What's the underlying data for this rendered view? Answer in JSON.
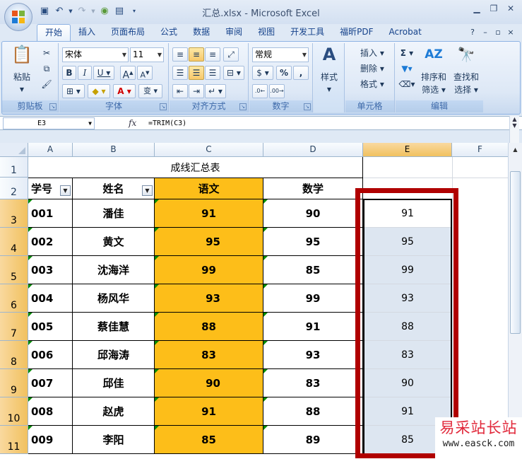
{
  "window": {
    "title": "汇总.xlsx - Microsoft Excel"
  },
  "ribbon": {
    "tabs": [
      "开始",
      "插入",
      "页面布局",
      "公式",
      "数据",
      "审阅",
      "视图",
      "开发工具",
      "福昕PDF",
      "Acrobat"
    ],
    "active_tab": "开始",
    "font_name": "宋体",
    "font_size": "11",
    "number_format": "常规",
    "labels": {
      "paste": "粘贴",
      "style": "样式",
      "insert": "插入",
      "delete": "删除",
      "format": "格式",
      "sort_filter_1": "排序和",
      "sort_filter_2": "筛选",
      "find_select_1": "查找和",
      "find_select_2": "选择"
    },
    "groups": [
      "剪贴板",
      "字体",
      "对齐方式",
      "数字",
      "单元格",
      "编辑"
    ]
  },
  "formula_bar": {
    "name_box": "E3",
    "fx": "fx",
    "formula": "=TRIM(C3)"
  },
  "sheet": {
    "columns": [
      "A",
      "B",
      "C",
      "D",
      "E",
      "F"
    ],
    "row_numbers": [
      "1",
      "2",
      "3",
      "4",
      "5",
      "6",
      "7",
      "8",
      "9",
      "10",
      "11"
    ],
    "table_title": "成线汇总表",
    "headers": [
      "学号",
      "姓名",
      "语文",
      "数学"
    ],
    "rows": [
      {
        "id": "001",
        "name": "潘佳",
        "chinese": "91",
        "math": "90",
        "e": "91"
      },
      {
        "id": "002",
        "name": "黄文",
        "chinese": "95",
        "math": "95",
        "e": "95"
      },
      {
        "id": "003",
        "name": "沈海洋",
        "chinese": "99",
        "math": "85",
        "e": "99"
      },
      {
        "id": "004",
        "name": "杨风华",
        "chinese": "93",
        "math": "99",
        "e": "93"
      },
      {
        "id": "005",
        "name": "蔡佳慧",
        "chinese": "88",
        "math": "91",
        "e": "88"
      },
      {
        "id": "006",
        "name": "邱海涛",
        "chinese": "83",
        "math": "93",
        "e": "83"
      },
      {
        "id": "007",
        "name": "邱佳",
        "chinese": "90",
        "math": "83",
        "e": "90"
      },
      {
        "id": "008",
        "name": "赵虎",
        "chinese": "91",
        "math": "88",
        "e": "91"
      },
      {
        "id": "009",
        "name": "李阳",
        "chinese": "85",
        "math": "89",
        "e": "85"
      }
    ]
  },
  "watermark": {
    "line1": "易采站长站",
    "line2": "www.easck.com"
  },
  "colors": {
    "highlight": "#fdbe19",
    "red_frame": "#b00000",
    "selection_fill": "#dde6f1"
  }
}
